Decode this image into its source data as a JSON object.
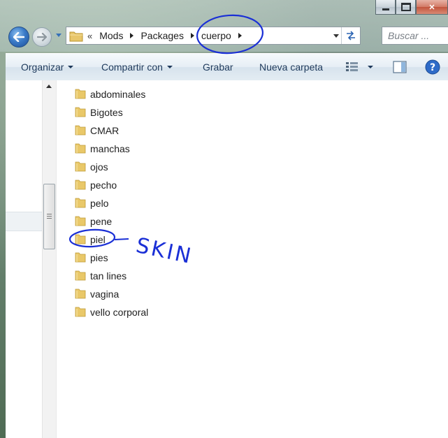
{
  "window": {
    "caption": {
      "minimize_label": "",
      "maximize_label": "",
      "close_label": "✕"
    }
  },
  "nav": {
    "overflow": "«",
    "breadcrumbs": [
      "Mods",
      "Packages",
      "cuerpo"
    ],
    "search_placeholder": "Buscar ..."
  },
  "toolbar": {
    "organize": "Organizar",
    "share": "Compartir con",
    "burn": "Grabar",
    "new_folder": "Nueva carpeta"
  },
  "folders": [
    "abdominales",
    "Bigotes",
    "CMAR",
    "manchas",
    "ojos",
    "pecho",
    "pelo",
    "pene",
    "piel",
    "pies",
    "tan lines",
    "vagina",
    "vello corporal"
  ],
  "annotation": {
    "text": "SKIN",
    "color": "#1a2fd6"
  }
}
